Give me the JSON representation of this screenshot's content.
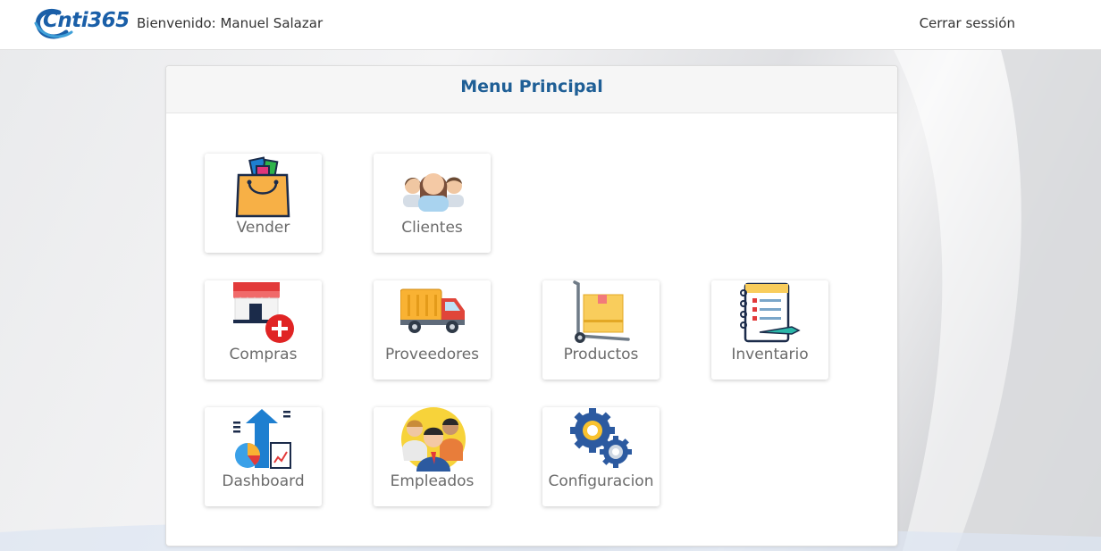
{
  "header": {
    "logo_text": "Cnti365",
    "welcome": "Bienvenido: Manuel Salazar",
    "logout": "Cerrar sessión"
  },
  "panel": {
    "title": "Menu Principal"
  },
  "menu": {
    "vender": {
      "label": "Vender",
      "icon": "shopping-bag-icon"
    },
    "clientes": {
      "label": "Clientes",
      "icon": "customers-icon"
    },
    "compras": {
      "label": "Compras",
      "icon": "store-add-icon"
    },
    "proveedores": {
      "label": "Proveedores",
      "icon": "delivery-truck-icon"
    },
    "productos": {
      "label": "Productos",
      "icon": "hand-truck-box-icon"
    },
    "inventario": {
      "label": "Inventario",
      "icon": "notebook-checklist-icon"
    },
    "dashboard": {
      "label": "Dashboard",
      "icon": "growth-chart-icon"
    },
    "empleados": {
      "label": "Empleados",
      "icon": "employees-icon"
    },
    "configuracion": {
      "label": "Configuracion",
      "icon": "gears-icon"
    }
  },
  "colors": {
    "brand_blue": "#1a5fa8",
    "title_blue": "#1f5f96",
    "tile_label": "#6b6b6b"
  }
}
